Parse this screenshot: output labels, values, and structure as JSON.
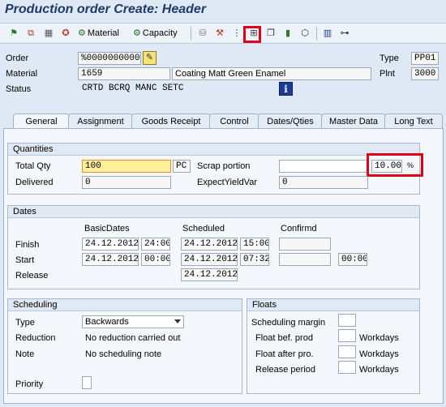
{
  "title": "Production order Create: Header",
  "toolbar": {
    "material_label": "Material",
    "capacity_label": "Capacity"
  },
  "header": {
    "order_label": "Order",
    "order_value": "%00000000001",
    "type_label": "Type",
    "type_value": "PP01",
    "material_label": "Material",
    "material_value": "1659",
    "material_desc": "Coating Matt Green Enamel",
    "plant_label": "Plnt",
    "plant_value": "3000",
    "status_label": "Status",
    "status_value": "CRTD BCRQ MANC SETC",
    "info_glyph": "i"
  },
  "tabs": [
    {
      "label": "General"
    },
    {
      "label": "Assignment"
    },
    {
      "label": "Goods Receipt"
    },
    {
      "label": "Control"
    },
    {
      "label": "Dates/Qties"
    },
    {
      "label": "Master Data"
    },
    {
      "label": "Long Text"
    }
  ],
  "quantities": {
    "title": "Quantities",
    "total_qty_label": "Total Qty",
    "total_qty_value": "100",
    "unit_value": "PC",
    "scrap_label": "Scrap portion",
    "scrap_value": "",
    "scrap_pct_value": "10.00",
    "pct_symbol": "%",
    "delivered_label": "Delivered",
    "delivered_value": "0",
    "expect_yield_label": "ExpectYieldVar",
    "expect_yield_value": "0"
  },
  "dates": {
    "title": "Dates",
    "col_basic": "BasicDates",
    "col_scheduled": "Scheduled",
    "col_confirmed": "Confirmd",
    "finish_label": "Finish",
    "finish_basic_date": "24.12.2012",
    "finish_basic_time": "24:00",
    "finish_sched_date": "24.12.2012",
    "finish_sched_time": "15:00",
    "start_label": "Start",
    "start_basic_date": "24.12.2012",
    "start_basic_time": "00:00",
    "start_sched_date": "24.12.2012",
    "start_sched_time": "07:32",
    "start_conf_time": "00:00",
    "release_label": "Release",
    "release_sched_date": "24.12.2012"
  },
  "scheduling": {
    "title": "Scheduling",
    "type_label": "Type",
    "type_value": "Backwards",
    "reduction_label": "Reduction",
    "reduction_value": "No reduction carried out",
    "note_label": "Note",
    "note_value": "No scheduling note",
    "priority_label": "Priority",
    "priority_value": ""
  },
  "floats": {
    "title": "Floats",
    "margin_label": "Scheduling margin",
    "bef_label": "Float bef. prod",
    "after_label": "Float after pro.",
    "release_label": "Release period",
    "unit_label": "Workdays"
  }
}
